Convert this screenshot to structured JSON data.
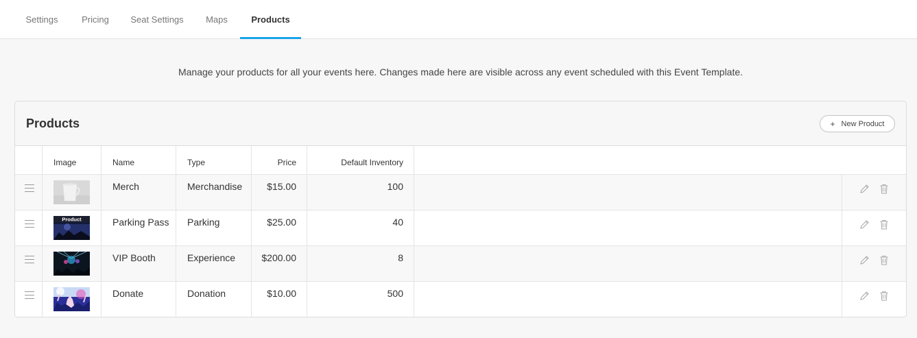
{
  "tabs": [
    {
      "label": "Settings",
      "active": false
    },
    {
      "label": "Pricing",
      "active": false
    },
    {
      "label": "Seat Settings",
      "active": false
    },
    {
      "label": "Maps",
      "active": false
    },
    {
      "label": "Products",
      "active": true
    }
  ],
  "intro_text": "Manage your products for all your events here. Changes made here are visible across any event scheduled with this Event Template.",
  "card": {
    "title": "Products",
    "new_button": "New Product",
    "new_button_icon": "plus-icon"
  },
  "columns": {
    "image": "Image",
    "name": "Name",
    "type": "Type",
    "price": "Price",
    "inventory": "Default Inventory"
  },
  "rows": [
    {
      "name": "Merch",
      "type": "Merchandise",
      "price": "$15.00",
      "inventory": "100",
      "thumb": "white-mug-photo"
    },
    {
      "name": "Parking Pass",
      "type": "Parking",
      "price": "$25.00",
      "inventory": "40",
      "thumb": "concert-stage-photo",
      "thumb_caption": "Product"
    },
    {
      "name": "VIP Booth",
      "type": "Experience",
      "price": "$200.00",
      "inventory": "8",
      "thumb": "dj-lights-photo"
    },
    {
      "name": "Donate",
      "type": "Donation",
      "price": "$10.00",
      "inventory": "500",
      "thumb": "crowd-concert-photo"
    }
  ],
  "colors": {
    "accent": "#1aa3e8"
  }
}
